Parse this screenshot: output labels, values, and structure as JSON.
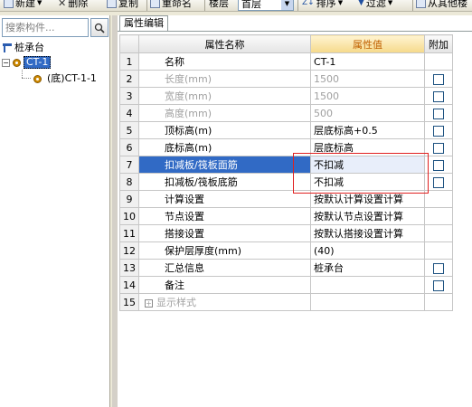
{
  "toolbar": {
    "new_label": "新建",
    "delete_label": "删除",
    "copy_label": "复制",
    "rename_label": "重命名",
    "floor_label": "楼层",
    "floor_value": "首层",
    "sort_label": "排序",
    "filter_label": "过滤",
    "copy_from_label": "从其他楼"
  },
  "left_panel": {
    "search_placeholder": "搜索构件...",
    "tree": {
      "root_label": "桩承台",
      "child_label": "CT-1",
      "grandchild_label": "(底)CT-1-1"
    }
  },
  "tab": {
    "label": "属性编辑"
  },
  "grid": {
    "headers": {
      "name": "属性名称",
      "value": "属性值",
      "extra": "附加"
    },
    "rows": [
      {
        "num": "1",
        "name": "名称",
        "value": "CT-1",
        "gray": false,
        "checkbox": false
      },
      {
        "num": "2",
        "name": "长度(mm)",
        "value": "1500",
        "gray": true,
        "checkbox": true
      },
      {
        "num": "3",
        "name": "宽度(mm)",
        "value": "1500",
        "gray": true,
        "checkbox": true
      },
      {
        "num": "4",
        "name": "高度(mm)",
        "value": "500",
        "gray": true,
        "checkbox": true
      },
      {
        "num": "5",
        "name": "顶标高(m)",
        "value": "层底标高+0.5",
        "gray": false,
        "checkbox": true
      },
      {
        "num": "6",
        "name": "底标高(m)",
        "value": "层底标高",
        "gray": false,
        "checkbox": true
      },
      {
        "num": "7",
        "name": "扣减板/筏板面筋",
        "value": "不扣减",
        "gray": false,
        "checkbox": true,
        "selected": true
      },
      {
        "num": "8",
        "name": "扣减板/筏板底筋",
        "value": "不扣减",
        "gray": false,
        "checkbox": true
      },
      {
        "num": "9",
        "name": "计算设置",
        "value": "按默认计算设置计算",
        "gray": false,
        "checkbox": false
      },
      {
        "num": "10",
        "name": "节点设置",
        "value": "按默认节点设置计算",
        "gray": false,
        "checkbox": false
      },
      {
        "num": "11",
        "name": "搭接设置",
        "value": "按默认搭接设置计算",
        "gray": false,
        "checkbox": false
      },
      {
        "num": "12",
        "name": "保护层厚度(mm)",
        "value": "(40)",
        "gray": false,
        "checkbox": false
      },
      {
        "num": "13",
        "name": "汇总信息",
        "value": "桩承台",
        "gray": false,
        "checkbox": true
      },
      {
        "num": "14",
        "name": "备注",
        "value": "",
        "gray": false,
        "checkbox": true
      },
      {
        "num": "15",
        "name": "显示样式",
        "value": "",
        "gray": true,
        "checkbox": false,
        "expandable": true
      }
    ]
  },
  "colors": {
    "selection": "#316ac5",
    "highlight_box": "#e02020",
    "value_header": "#c06000"
  }
}
